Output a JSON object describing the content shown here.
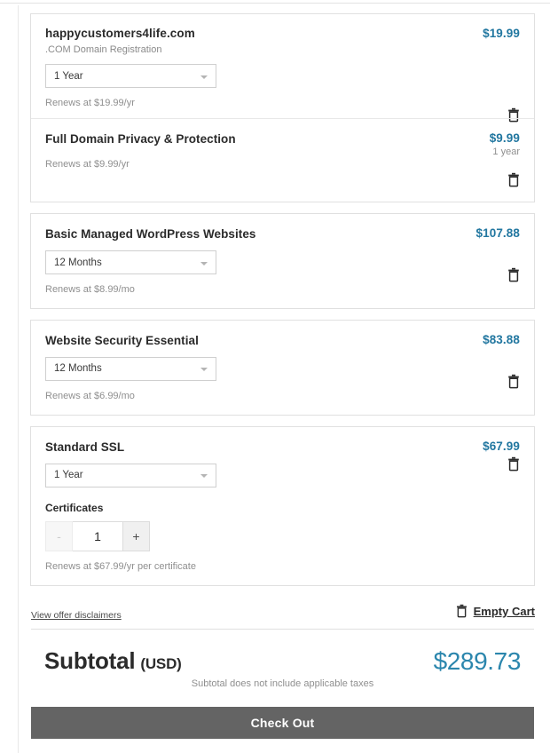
{
  "colors": {
    "price": "#2277a0",
    "subtotal_amount": "#2b86ad",
    "checkout_bg": "#646464",
    "card_border": "#e0e0e0"
  },
  "cart": {
    "items": [
      {
        "title": "happycustomers4life.com",
        "subtitle": ".COM Domain Registration",
        "term": "1 Year",
        "renews": "Renews at $19.99/yr",
        "price": "$19.99",
        "price_sub": "",
        "delete_icon": "trash-icon"
      },
      {
        "title": "Full Domain Privacy & Protection",
        "subtitle": "",
        "term": "",
        "renews": "Renews at $9.99/yr",
        "price": "$9.99",
        "price_sub": "1 year",
        "delete_icon": "trash-icon"
      },
      {
        "title": "Basic Managed WordPress Websites",
        "subtitle": "",
        "term": "12 Months",
        "renews": "Renews at $8.99/mo",
        "price": "$107.88",
        "price_sub": "",
        "delete_icon": "trash-icon"
      },
      {
        "title": "Website Security Essential",
        "subtitle": "",
        "term": "12 Months",
        "renews": "Renews at $6.99/mo",
        "price": "$83.88",
        "price_sub": "",
        "delete_icon": "trash-icon"
      },
      {
        "title": "Standard SSL",
        "subtitle": "",
        "term": "1 Year",
        "renews": "Renews at $67.99/yr per certificate",
        "price": "$67.99",
        "price_sub": "",
        "delete_icon": "trash-icon",
        "quantity_label": "Certificates",
        "quantity_value": "1",
        "decrement_label": "-",
        "increment_label": "+"
      }
    ]
  },
  "footer": {
    "disclaimers_label": "View offer disclaimers",
    "empty_cart_label": "Empty Cart",
    "empty_cart_icon": "trash-icon",
    "subtotal_label": "Subtotal",
    "subtotal_currency": "(USD)",
    "subtotal_amount": "$289.73",
    "tax_note": "Subtotal does not include applicable taxes",
    "checkout_label": "Check Out"
  }
}
